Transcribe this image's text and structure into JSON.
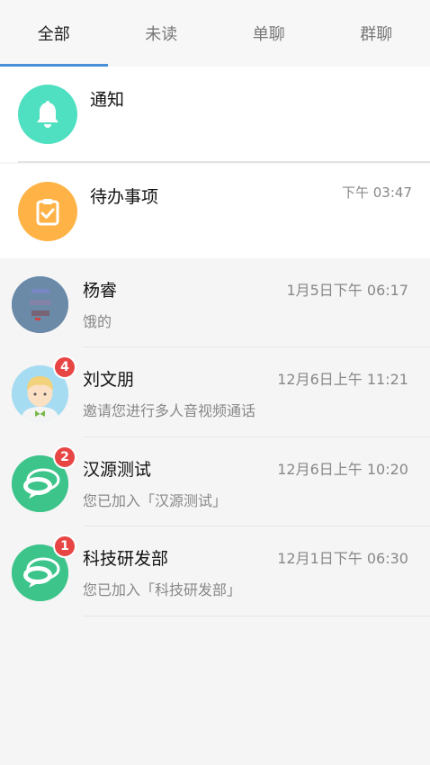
{
  "tabs": [
    {
      "label": "全部",
      "active": true
    },
    {
      "label": "未读",
      "active": false
    },
    {
      "label": "单聊",
      "active": false
    },
    {
      "label": "群聊",
      "active": false
    }
  ],
  "notice": {
    "title": "通知",
    "icon": "bell-icon",
    "color": "#4ee0c0"
  },
  "todo": {
    "title": "待办事项",
    "time": "下午 03:47",
    "icon": "clipboard-check-icon",
    "color": "#ffb347"
  },
  "chats": [
    {
      "name": "杨睿",
      "time": "1月5日下午 06:17",
      "preview": "饿的",
      "badge": ""
    },
    {
      "name": "刘文朋",
      "time": "12月6日上午 11:21",
      "preview": "邀请您进行多人音视频通话",
      "badge": "4"
    },
    {
      "name": "汉源测试",
      "time": "12月6日上午 10:20",
      "preview": "您已加入「汉源测试」",
      "badge": "2"
    },
    {
      "name": "科技研发部",
      "time": "12月1日下午 06:30",
      "preview": "您已加入「科技研发部」",
      "badge": "1"
    }
  ],
  "colors": {
    "accent": "#4a90d9",
    "badge": "#e84545",
    "group_avatar": "#3cc48a"
  }
}
